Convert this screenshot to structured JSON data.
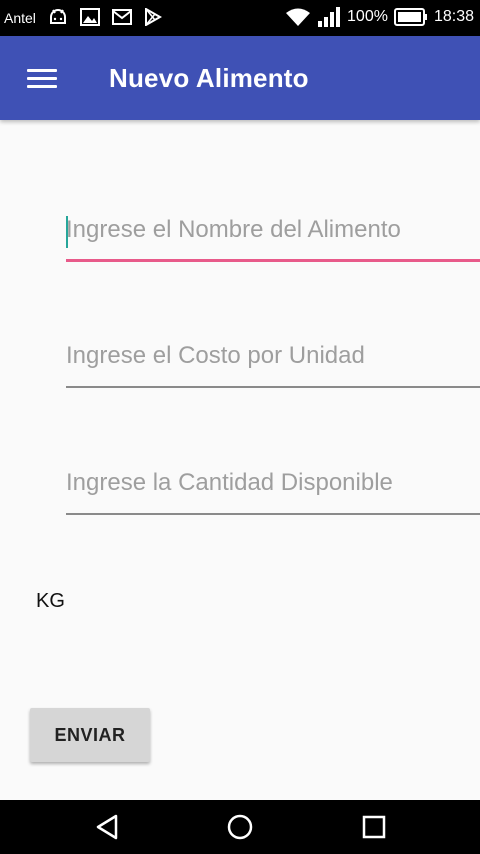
{
  "status_bar": {
    "carrier": "Antel",
    "battery": "100%",
    "time": "18:38",
    "icons_left": [
      "android-icon",
      "image-icon",
      "mail-icon",
      "play-store-icon"
    ],
    "icons_right": [
      "wifi-icon",
      "signal-icon",
      "battery-icon"
    ]
  },
  "app_bar": {
    "title": "Nuevo Alimento",
    "menu_icon": "hamburger-menu-icon",
    "color": "#3f51b5"
  },
  "form": {
    "name_field": {
      "placeholder": "Ingrese el Nombre del Alimento",
      "value": ""
    },
    "cost_field": {
      "placeholder": "Ingrese el Costo por Unidad",
      "value": ""
    },
    "quantity_field": {
      "placeholder": "Ingrese la Cantidad Disponible",
      "value": ""
    },
    "unit_label": "KG",
    "submit_label": "ENVIAR",
    "focus_color": "#e85a8a"
  },
  "nav_bar": {
    "buttons": [
      "back-icon",
      "home-icon",
      "recents-icon"
    ]
  }
}
